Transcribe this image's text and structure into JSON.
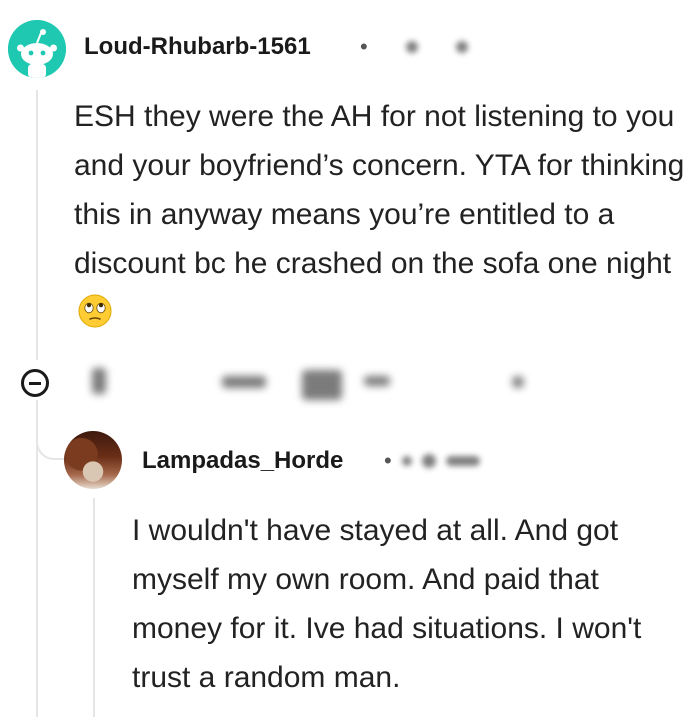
{
  "comment": {
    "username": "Loud-Rhubarb-1561",
    "separator": "•",
    "body_text": "ESH they were the AH for not listening to you and your boyfriend’s concern. YTA for thinking this in anyway means you’re entitled to a discount bc he crashed on the sofa one night",
    "emoji": "face-with-rolling-eyes-icon",
    "avatar_color": "#1fc8b1"
  },
  "reply": {
    "username": "Lampadas_Horde",
    "separator": "•",
    "body_text": "I wouldn't have stayed at all. And got myself my own room. And paid that money for it. Ive had situations. I won't trust a random man."
  },
  "colors": {
    "text": "#1a1a1b",
    "thread_line": "#e5e5e5",
    "emoji_face": "#ffcc33"
  }
}
